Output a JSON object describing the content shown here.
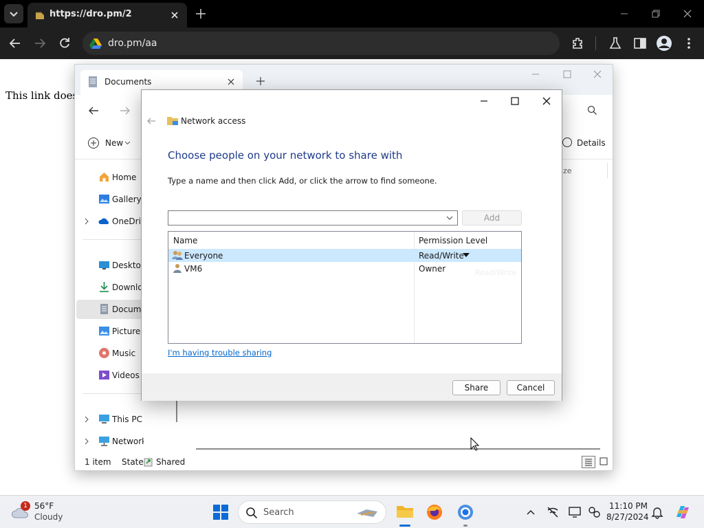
{
  "browser": {
    "tab_title": "https://dro.pm/2",
    "address": "dro.pm/aa",
    "page_text": "This link does n"
  },
  "explorer": {
    "tab_title": "Documents",
    "new_label": "New",
    "details_label": "Details",
    "size_col_fragment": "ze",
    "nav": [
      {
        "label": "Home"
      },
      {
        "label": "Gallery"
      },
      {
        "label": "OneDrive"
      },
      {
        "label": "Desktop"
      },
      {
        "label": "Downloads"
      },
      {
        "label": "Documents"
      },
      {
        "label": "Pictures"
      },
      {
        "label": "Music"
      },
      {
        "label": "Videos"
      },
      {
        "label": "This PC"
      },
      {
        "label": "Network"
      }
    ],
    "status": {
      "items": "1 item",
      "state_label": "State:",
      "state_value": "Shared"
    }
  },
  "dialog": {
    "breadcrumb": "Network access",
    "heading": "Choose people on your network to share with",
    "instruction": "Type a name and then click Add, or click the arrow to find someone.",
    "name_input_value": "",
    "add_button": "Add",
    "columns": {
      "name": "Name",
      "permission": "Permission Level"
    },
    "rows": [
      {
        "name": "Everyone",
        "permission": "Read/Write",
        "selected": true
      },
      {
        "name": "VM6",
        "permission": "Owner",
        "selected": false
      }
    ],
    "ghost_text": "Read/Write",
    "trouble_link": "I'm having trouble sharing",
    "share_button": "Share",
    "cancel_button": "Cancel"
  },
  "taskbar": {
    "weather_badge": "1",
    "temperature": "56°F",
    "condition": "Cloudy",
    "search_placeholder": "Search",
    "time": "11:10 PM",
    "date": "8/27/2024"
  },
  "colors": {
    "accent": "#1a5fb4",
    "selection": "#cce8ff",
    "heading_blue": "#1e3a8a",
    "link": "#0066cc"
  }
}
